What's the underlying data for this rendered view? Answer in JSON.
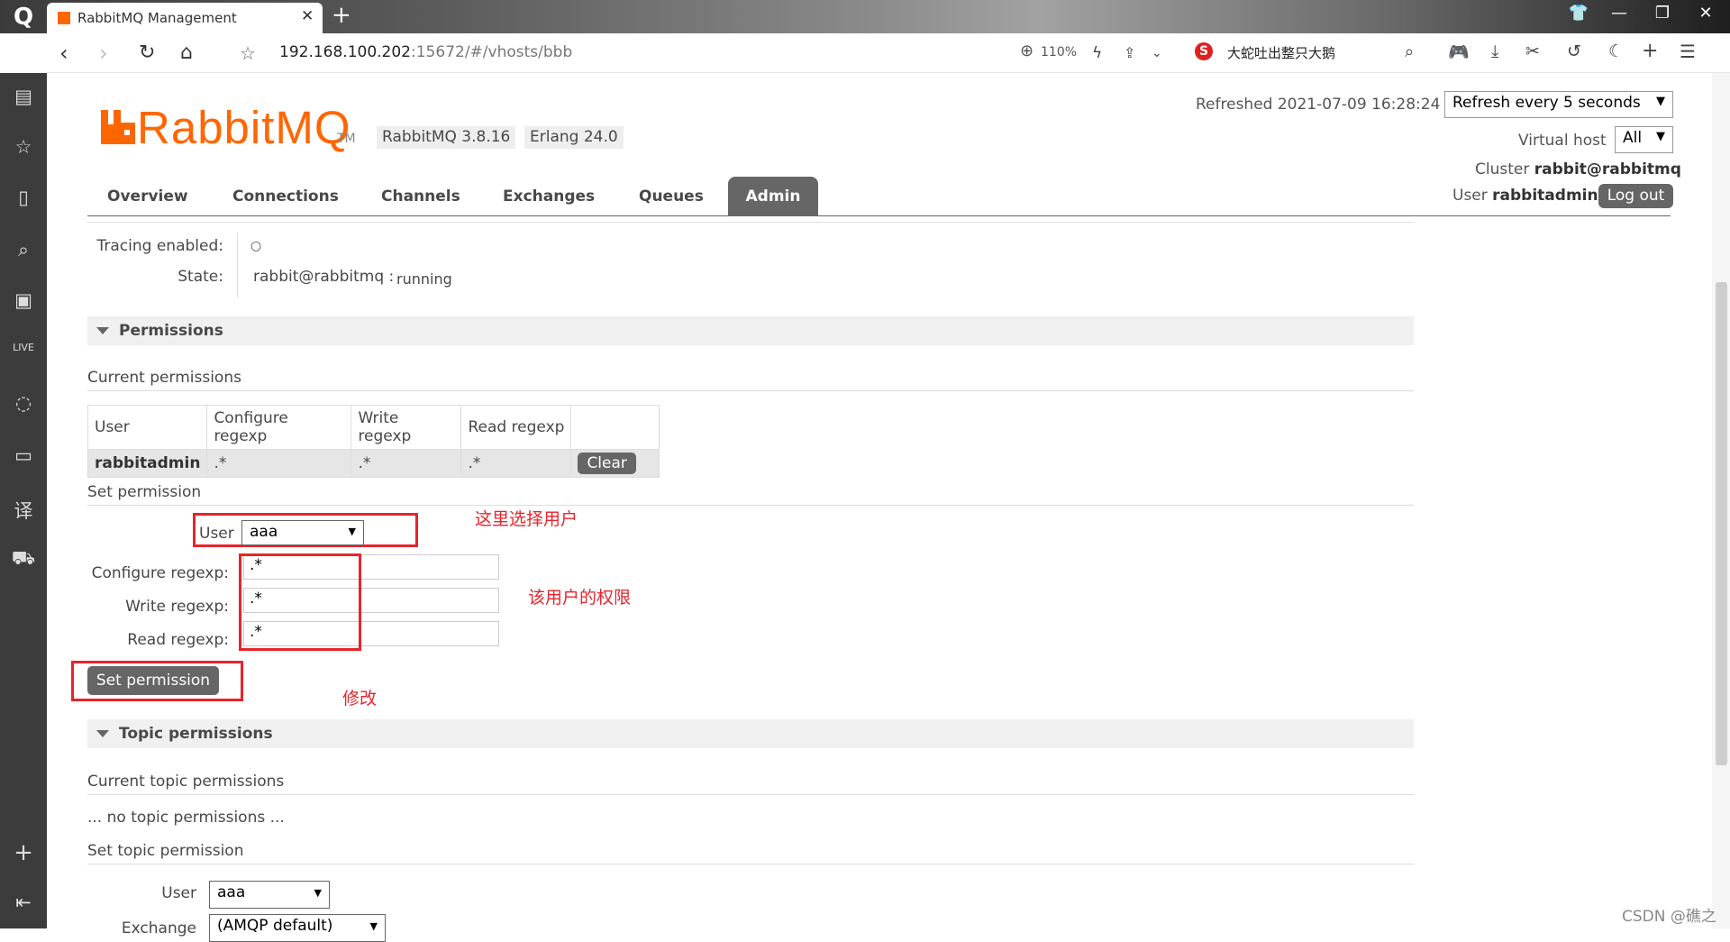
{
  "browser": {
    "tab_title": "RabbitMQ Management",
    "url_host": "192.168.100.202",
    "url_rest": ":15672/#/vhosts/bbb",
    "zoom": "110%",
    "search_text": "大蛇吐出整只大鹅"
  },
  "header": {
    "brand": "RabbitMQ",
    "tm": "TM",
    "version": "RabbitMQ 3.8.16",
    "erlang": "Erlang 24.0",
    "refreshed": "Refreshed 2021-07-09 16:28:24",
    "refresh_select": "Refresh every 5 seconds",
    "vhost_label": "Virtual host",
    "vhost_value": "All",
    "cluster_label": "Cluster",
    "cluster_value": "rabbit@rabbitmq",
    "user_label": "User",
    "user_value": "rabbitadmin",
    "logout": "Log out"
  },
  "nav": {
    "tabs": [
      "Overview",
      "Connections",
      "Channels",
      "Exchanges",
      "Queues",
      "Admin"
    ],
    "active": "Admin"
  },
  "overview": {
    "tracing_label": "Tracing enabled:",
    "tracing_value": "○",
    "state_label": "State:",
    "state_node": "rabbit@rabbitmq :",
    "state_value": "running"
  },
  "permissions": {
    "section_title": "Permissions",
    "current_title": "Current permissions",
    "columns": [
      "User",
      "Configure regexp",
      "Write regexp",
      "Read regexp"
    ],
    "rows": [
      {
        "user": "rabbitadmin",
        "configure": ".*",
        "write": ".*",
        "read": ".*"
      }
    ],
    "clear_label": "Clear",
    "set_title": "Set permission",
    "user_label": "User",
    "user_value": "aaa",
    "configure_label": "Configure regexp:",
    "configure_value": ".*",
    "write_label": "Write regexp:",
    "write_value": ".*",
    "read_label": "Read regexp:",
    "read_value": ".*",
    "submit_label": "Set permission"
  },
  "annotations": {
    "select_user": "这里选择用户",
    "user_permissions": "该用户的权限",
    "modify": "修改"
  },
  "topic_permissions": {
    "section_title": "Topic permissions",
    "current_title": "Current topic permissions",
    "empty_text": "... no topic permissions ...",
    "set_title": "Set topic permission",
    "user_label": "User",
    "user_value": "aaa",
    "exchange_label": "Exchange",
    "exchange_value": "(AMQP default)"
  },
  "watermark": "CSDN @礁之"
}
